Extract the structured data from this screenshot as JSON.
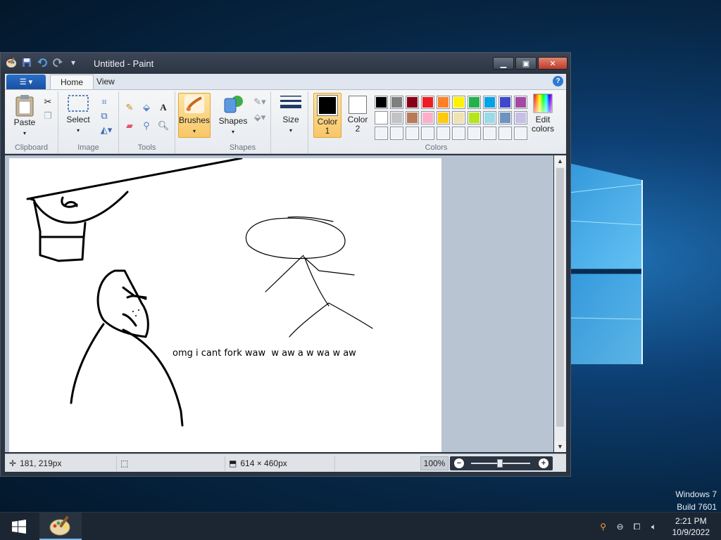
{
  "desktop": {
    "watermark_line1": "Windows 7",
    "watermark_line2": "Build 7601"
  },
  "window": {
    "title": "Untitled - Paint",
    "controls": {
      "minimize": "minimize-icon",
      "maximize": "maximize-icon",
      "close": "close-icon"
    }
  },
  "ribbon": {
    "tabs": [
      {
        "label": "Home",
        "active": true
      },
      {
        "label": "View",
        "active": false
      }
    ],
    "groups": {
      "clipboard": "Clipboard",
      "image": "Image",
      "tools": "Tools",
      "shapes": "Shapes",
      "colors": "Colors"
    },
    "buttons": {
      "paste": "Paste",
      "select": "Select",
      "brushes": "Brushes",
      "shapes": "Shapes",
      "size": "Size",
      "color1_line1": "Color",
      "color1_line2": "1",
      "color2_line1": "Color",
      "color2_line2": "2",
      "edit_colors_line1": "Edit",
      "edit_colors_line2": "colors"
    },
    "color1": "#000000",
    "color2": "#ffffff",
    "palette_row1": [
      "#000000",
      "#7f7f7f",
      "#880015",
      "#ed1c24",
      "#ff7f27",
      "#fff200",
      "#22b14c",
      "#00a2e8",
      "#3f48cc",
      "#a349a4"
    ],
    "palette_row2": [
      "#ffffff",
      "#c3c3c3",
      "#b97a57",
      "#ffaec9",
      "#ffc90e",
      "#efe4b0",
      "#b5e61d",
      "#99d9ea",
      "#7092be",
      "#c8bfe7"
    ],
    "palette_row3": [
      "#f0f4f8",
      "#f0f4f8",
      "#f0f4f8",
      "#f0f4f8",
      "#f0f4f8",
      "#f0f4f8",
      "#f0f4f8",
      "#f0f4f8",
      "#f0f4f8",
      "#f0f4f8"
    ]
  },
  "canvas": {
    "text": "omg i cant fork waw  w aw a w wa w aw"
  },
  "status": {
    "cursor_pos": "181, 219px",
    "image_size": "614 × 460px",
    "zoom": "100%"
  },
  "taskbar": {
    "time": "2:21 PM",
    "date": "10/9/2022"
  }
}
